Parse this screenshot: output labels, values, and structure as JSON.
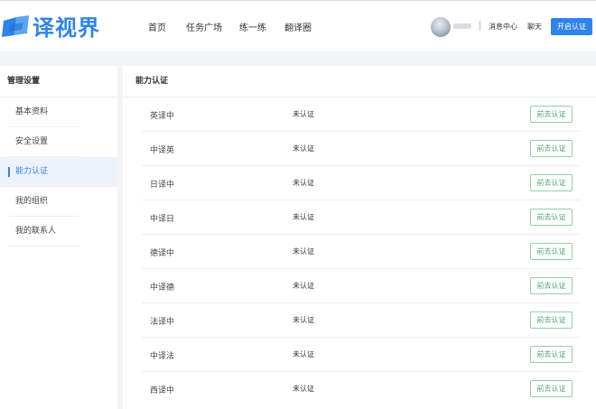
{
  "brand": {
    "name": "译视界",
    "color": "#2e84e8"
  },
  "nav": [
    {
      "label": "首页"
    },
    {
      "label": "任务广场"
    },
    {
      "label": "练一练"
    },
    {
      "label": "翻译圈"
    }
  ],
  "header": {
    "messages_label": "消息中心",
    "chat_label": "聊天",
    "primary_button": "开启认证"
  },
  "sidebar": {
    "title": "管理设置",
    "items": [
      {
        "label": "基本资料"
      },
      {
        "label": "安全设置"
      },
      {
        "label": "能力认证"
      },
      {
        "label": "我的组织"
      },
      {
        "label": "我的联系人"
      }
    ]
  },
  "main": {
    "title": "能力认证",
    "rows": [
      {
        "lang": "英译中",
        "status": "未认证",
        "action": "前去认证"
      },
      {
        "lang": "中译英",
        "status": "未认证",
        "action": "前去认证"
      },
      {
        "lang": "日译中",
        "status": "未认证",
        "action": "前去认证"
      },
      {
        "lang": "中译日",
        "status": "未认证",
        "action": "前去认证"
      },
      {
        "lang": "德译中",
        "status": "未认证",
        "action": "前去认证"
      },
      {
        "lang": "中译德",
        "status": "未认证",
        "action": "前去认证"
      },
      {
        "lang": "法译中",
        "status": "未认证",
        "action": "前去认证"
      },
      {
        "lang": "中译法",
        "status": "未认证",
        "action": "前去认证"
      },
      {
        "lang": "西译中",
        "status": "未认证",
        "action": "前去认证"
      }
    ]
  }
}
